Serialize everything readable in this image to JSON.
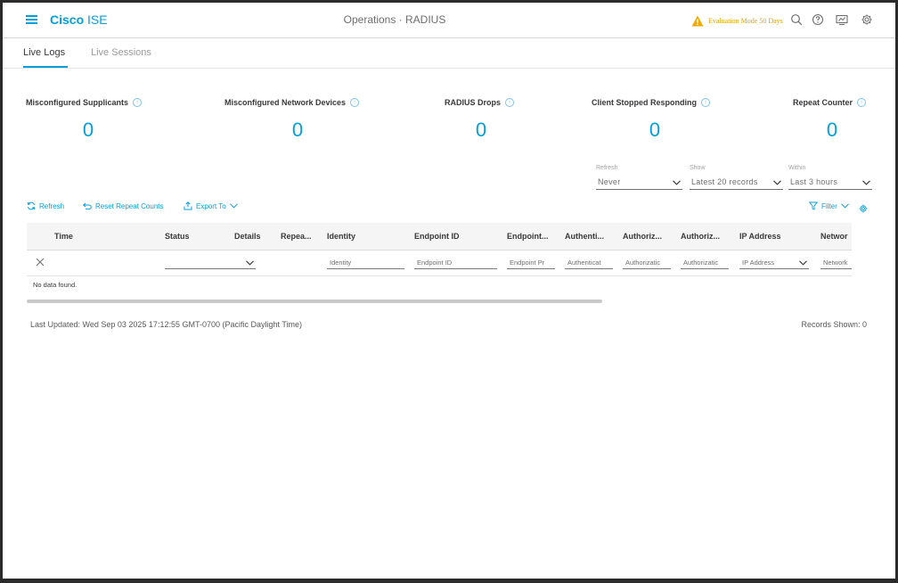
{
  "header": {
    "brand_bold": "Cisco",
    "brand_light": "ISE",
    "title": "Operations · RADIUS",
    "eval_text": "Evaluation Mode 50 Days",
    "accent": "#049fd9",
    "warning_color": "#e8a200"
  },
  "tabs": [
    {
      "label": "Live Logs",
      "active": true
    },
    {
      "label": "Live Sessions",
      "active": false
    }
  ],
  "metrics": [
    {
      "label": "Misconfigured Supplicants",
      "value": "0"
    },
    {
      "label": "Misconfigured Network Devices",
      "value": "0"
    },
    {
      "label": "RADIUS Drops",
      "value": "0"
    },
    {
      "label": "Client Stopped Responding",
      "value": "0"
    },
    {
      "label": "Repeat Counter",
      "value": "0"
    }
  ],
  "filters": {
    "refresh": {
      "label": "Refresh",
      "value": "Never"
    },
    "show": {
      "label": "Show",
      "value": "Latest 20 records"
    },
    "within": {
      "label": "Within",
      "value": "Last 3 hours"
    }
  },
  "toolbar": {
    "refresh": "Refresh",
    "reset": "Reset Repeat Counts",
    "export": "Export To",
    "filter": "Filter"
  },
  "table": {
    "columns": [
      "Time",
      "Status",
      "Details",
      "Repea...",
      "Identity",
      "Endpoint ID",
      "Endpoint...",
      "Authenti...",
      "Authoriz...",
      "Authoriz...",
      "IP Address",
      "Networ"
    ],
    "filter_placeholders": [
      "",
      "",
      "",
      "",
      "Identity",
      "Endpoint ID",
      "Endpoint Pr",
      "Authenticat",
      "Authorizatic",
      "Authorizatic",
      "IP Address",
      "Network"
    ],
    "empty_text": "No data found."
  },
  "footer": {
    "last_updated": "Last Updated: Wed Sep 03 2025 17:12:55 GMT-0700 (Pacific Daylight Time)",
    "records_shown": "Records Shown: 0"
  }
}
